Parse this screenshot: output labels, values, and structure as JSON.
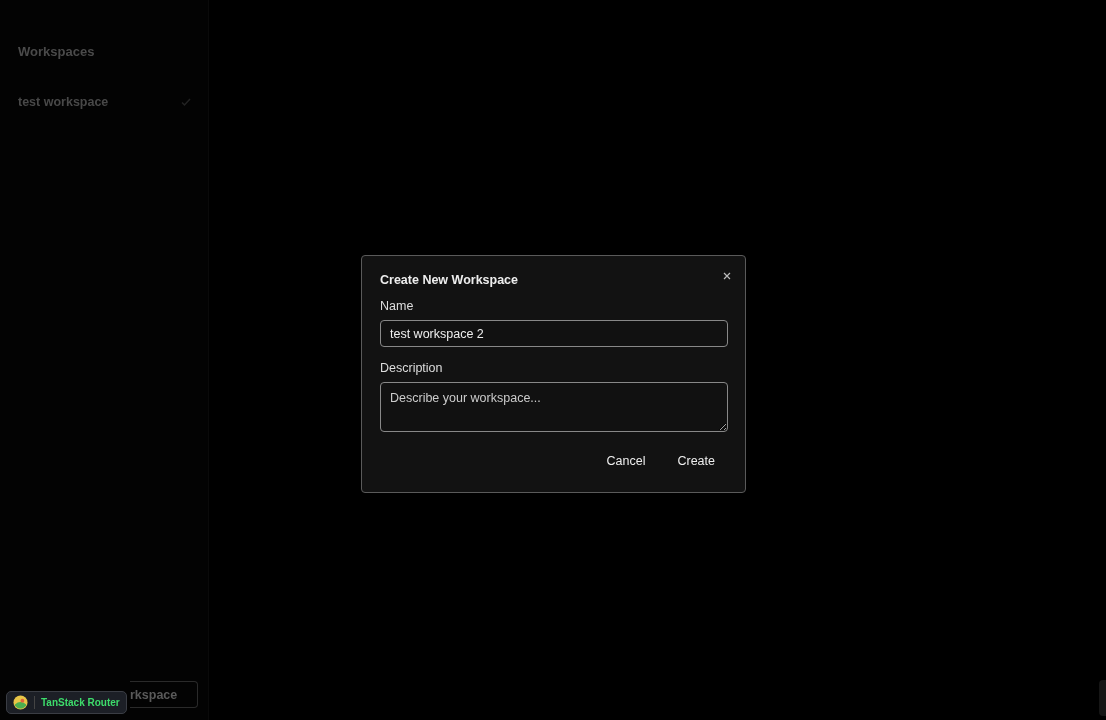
{
  "sidebar": {
    "title": "Workspaces",
    "items": [
      {
        "label": "test workspace",
        "selected": true
      }
    ],
    "footer_button": "rkspace"
  },
  "dialog": {
    "title": "Create New Workspace",
    "fields": [
      {
        "kind": "input",
        "label": "Name",
        "value": "test workspace 2"
      },
      {
        "kind": "textarea",
        "label": "Description",
        "placeholder": "Describe your workspace..."
      }
    ],
    "buttons": [
      "Cancel",
      "Create"
    ]
  },
  "devtools_badge": {
    "label": "TanStack Router"
  }
}
